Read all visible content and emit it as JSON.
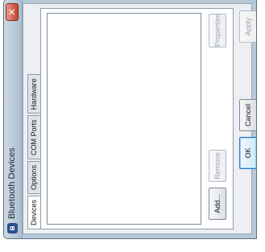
{
  "window": {
    "title": "Bluetooth Devices",
    "close_label": "✕"
  },
  "tabs": [
    {
      "label": "Devices"
    },
    {
      "label": "Options"
    },
    {
      "label": "COM Ports"
    },
    {
      "label": "Hardware"
    }
  ],
  "devices_tab": {
    "add_label": "Add...",
    "remove_label": "Remove",
    "properties_label": "Properties"
  },
  "footer": {
    "ok_label": "OK",
    "cancel_label": "Cancel",
    "apply_label": "Apply"
  },
  "icons": {
    "title_icon": "bluetooth-icon",
    "close_icon": "close-icon"
  },
  "colors": {
    "frame": "#b7c9d9",
    "close": "#c6402c",
    "default_button": "#2c78c6"
  }
}
